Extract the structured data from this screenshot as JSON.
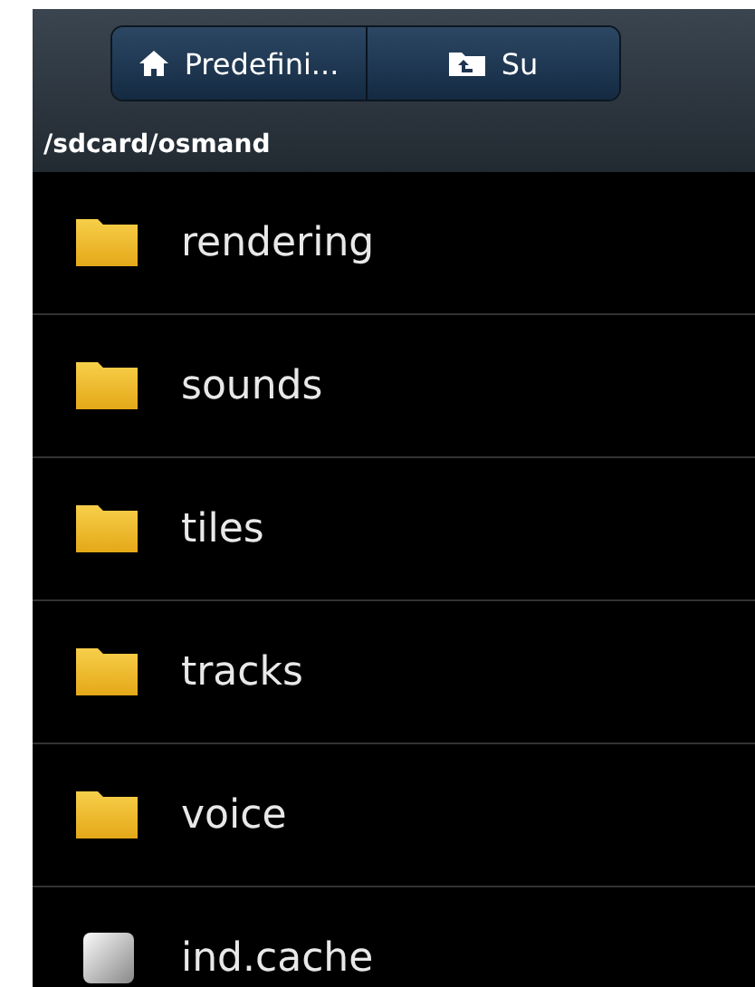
{
  "toolbar": {
    "buttons": [
      {
        "kind": "home",
        "label": "Predefini..."
      },
      {
        "kind": "up",
        "label": "Su"
      }
    ]
  },
  "path": "/sdcard/osmand",
  "items": [
    {
      "kind": "folder",
      "name": "rendering"
    },
    {
      "kind": "folder",
      "name": "sounds"
    },
    {
      "kind": "folder",
      "name": "tiles"
    },
    {
      "kind": "folder",
      "name": "tracks"
    },
    {
      "kind": "folder",
      "name": "voice"
    },
    {
      "kind": "file",
      "name": "ind.cache"
    }
  ]
}
